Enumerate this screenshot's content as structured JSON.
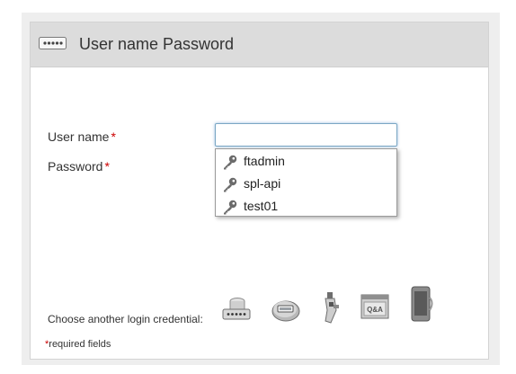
{
  "header": {
    "title": "User name Password",
    "icon": "password-dots-icon"
  },
  "form": {
    "username_label": "User name",
    "password_label": "Password",
    "required_mark": "*",
    "username_value": ""
  },
  "autocomplete": {
    "items": [
      {
        "label": "ftadmin",
        "icon": "key-icon"
      },
      {
        "label": "spl-api",
        "icon": "key-icon"
      },
      {
        "label": "test01",
        "icon": "key-icon"
      }
    ]
  },
  "footer": {
    "choose_label": "Choose another login credential:",
    "required_note_star": "*",
    "required_note": "required fields",
    "credentials": [
      "password-database-icon",
      "otp-token-icon",
      "smart-card-icon",
      "qa-security-questions-icon",
      "mobile-phone-icon"
    ]
  },
  "colors": {
    "required": "#cc0000",
    "header_bg": "#dcdcdc",
    "input_focus_border": "#7ba7c4"
  }
}
